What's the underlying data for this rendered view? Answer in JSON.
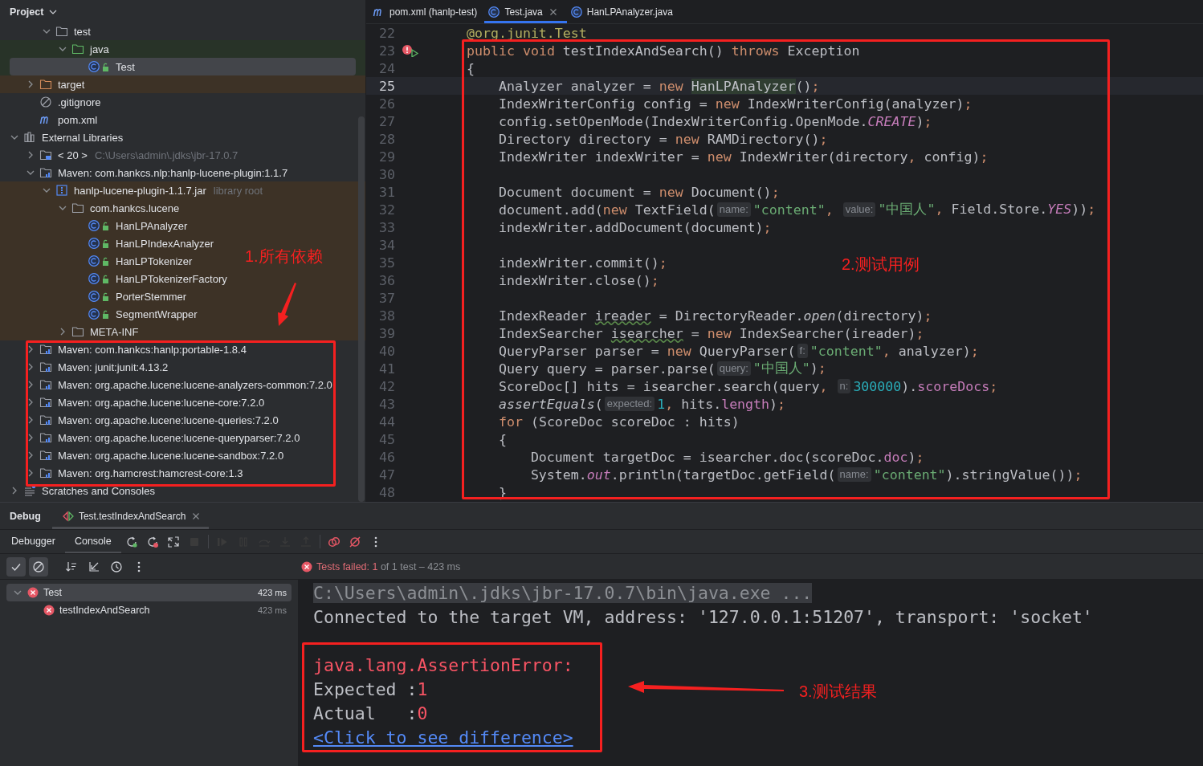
{
  "project": {
    "title": "Project",
    "tree": [
      {
        "children": [
          {
            "children": [
              {
                "label": "test",
                "kind": "folder",
                "expanded": true,
                "selected": false,
                "children": [
                  {
                    "label": "java",
                    "kind": "test-folder",
                    "expanded": true,
                    "selected": false,
                    "color": "#283328",
                    "children": [
                      {
                        "label": "Test",
                        "kind": "class",
                        "selected": true,
                        "color": "#283328"
                      }
                    ]
                  }
                ]
              }
            ]
          },
          {
            "label": "target",
            "kind": "excluded-folder",
            "expanded": false,
            "selected": false,
            "color": "#3d3226"
          },
          {
            "label": ".gitignore",
            "kind": "ignored",
            "selected": false
          },
          {
            "label": "pom.xml",
            "kind": "maven",
            "selected": false
          }
        ]
      },
      {
        "label": "External Libraries",
        "kind": "libraries",
        "expanded": true,
        "selected": false,
        "children": [
          {
            "label": "< 20 >",
            "kind": "sdk",
            "expanded": false,
            "selected": false,
            "hint": "C:\\Users\\admin\\.jdks\\jbr-17.0.7"
          },
          {
            "label": "Maven: com.hankcs.nlp:hanlp-lucene-plugin:1.1.7",
            "kind": "library",
            "expanded": true,
            "selected": false,
            "children": [
              {
                "label": "hanlp-lucene-plugin-1.1.7.jar",
                "kind": "archive",
                "expanded": true,
                "selected": false,
                "color": "#3d3226",
                "hint": "library root",
                "children": [
                  {
                    "label": "com.hankcs.lucene",
                    "kind": "folder",
                    "expanded": true,
                    "selected": false,
                    "color": "#3d3226",
                    "children": [
                      {
                        "label": "HanLPAnalyzer",
                        "kind": "class",
                        "selected": false,
                        "color": "#3d3226"
                      },
                      {
                        "label": "HanLPIndexAnalyzer",
                        "kind": "class",
                        "selected": false,
                        "color": "#3d3226"
                      },
                      {
                        "label": "HanLPTokenizer",
                        "kind": "class",
                        "selected": false,
                        "color": "#3d3226"
                      },
                      {
                        "label": "HanLPTokenizerFactory",
                        "kind": "class",
                        "selected": false,
                        "color": "#3d3226"
                      },
                      {
                        "label": "PorterStemmer",
                        "kind": "class",
                        "selected": false,
                        "color": "#3d3226"
                      },
                      {
                        "label": "SegmentWrapper",
                        "kind": "class",
                        "selected": false,
                        "color": "#3d3226"
                      }
                    ]
                  },
                  {
                    "label": "META-INF",
                    "kind": "folder",
                    "expanded": false,
                    "selected": false,
                    "color": "#3d3226"
                  }
                ]
              }
            ]
          },
          {
            "label": "Maven: com.hankcs:hanlp:portable-1.8.4",
            "kind": "library",
            "expanded": false,
            "selected": false
          },
          {
            "label": "Maven: junit:junit:4.13.2",
            "kind": "library",
            "expanded": false,
            "selected": false
          },
          {
            "label": "Maven: org.apache.lucene:lucene-analyzers-common:7.2.0",
            "kind": "library",
            "expanded": false,
            "selected": false
          },
          {
            "label": "Maven: org.apache.lucene:lucene-core:7.2.0",
            "kind": "library",
            "expanded": false,
            "selected": false
          },
          {
            "label": "Maven: org.apache.lucene:lucene-queries:7.2.0",
            "kind": "library",
            "expanded": false,
            "selected": false
          },
          {
            "label": "Maven: org.apache.lucene:lucene-queryparser:7.2.0",
            "kind": "library",
            "expanded": false,
            "selected": false
          },
          {
            "label": "Maven: org.apache.lucene:lucene-sandbox:7.2.0",
            "kind": "library",
            "expanded": false,
            "selected": false
          },
          {
            "label": "Maven: org.hamcrest:hamcrest-core:1.3",
            "kind": "library",
            "expanded": false,
            "selected": false
          }
        ]
      },
      {
        "label": "Scratches and Consoles",
        "kind": "scratches",
        "expanded": false,
        "selected": false
      }
    ]
  },
  "editor": {
    "tabs": [
      {
        "label": "pom.xml (hanlp-test)",
        "kind": "maven",
        "selected": false
      },
      {
        "label": "Test.java",
        "kind": "class",
        "selected": true,
        "closable": true
      },
      {
        "label": "HanLPAnalyzer.java",
        "kind": "class",
        "selected": false
      }
    ],
    "lines": [
      {
        "no": "22",
        "current": false,
        "tokens": [
          {
            "kind": "annotation",
            "text": "    @org.junit.Test"
          }
        ]
      },
      {
        "no": "23",
        "current": false,
        "run_error": true,
        "tokens": [
          {
            "kind": "keyword",
            "text": "    public "
          },
          {
            "kind": "keyword",
            "text": "void"
          },
          {
            "kind": "plain",
            "text": " testIndexAndSearch() "
          },
          {
            "kind": "keyword",
            "text": "throws"
          },
          {
            "kind": "plain",
            "text": " Exception"
          }
        ]
      },
      {
        "no": "24",
        "current": false,
        "tokens": [
          {
            "kind": "plain",
            "text": "    {"
          }
        ]
      },
      {
        "no": "25",
        "current": true,
        "tokens": [
          {
            "kind": "plain",
            "text": "        Analyzer analyzer = "
          },
          {
            "kind": "keyword",
            "text": "new "
          },
          {
            "kind": "match",
            "text": "HanLPAnalyzer"
          },
          {
            "kind": "plain",
            "text": "()"
          },
          {
            "kind": "punct",
            "text": ";"
          }
        ]
      },
      {
        "no": "26",
        "current": false,
        "tokens": [
          {
            "kind": "plain",
            "text": "        IndexWriterConfig config = "
          },
          {
            "kind": "keyword",
            "text": "new"
          },
          {
            "kind": "plain",
            "text": " IndexWriterConfig(analyzer)"
          },
          {
            "kind": "punct",
            "text": ";"
          }
        ]
      },
      {
        "no": "27",
        "current": false,
        "tokens": [
          {
            "kind": "plain",
            "text": "        config.setOpenMode(IndexWriterConfig.OpenMode."
          },
          {
            "kind": "static-field",
            "text": "CREATE"
          },
          {
            "kind": "plain",
            "text": ")"
          },
          {
            "kind": "punct",
            "text": ";"
          }
        ]
      },
      {
        "no": "28",
        "current": false,
        "tokens": [
          {
            "kind": "plain",
            "text": "        Directory directory = "
          },
          {
            "kind": "keyword",
            "text": "new"
          },
          {
            "kind": "plain",
            "text": " RAMDirectory()"
          },
          {
            "kind": "punct",
            "text": ";"
          }
        ]
      },
      {
        "no": "29",
        "current": false,
        "tokens": [
          {
            "kind": "plain",
            "text": "        IndexWriter indexWriter = "
          },
          {
            "kind": "keyword",
            "text": "new"
          },
          {
            "kind": "plain",
            "text": " IndexWriter(directory"
          },
          {
            "kind": "punct",
            "text": ","
          },
          {
            "kind": "plain",
            "text": " config)"
          },
          {
            "kind": "punct",
            "text": ";"
          }
        ]
      },
      {
        "no": "30",
        "current": false
      },
      {
        "no": "31",
        "current": false,
        "tokens": [
          {
            "kind": "plain",
            "text": "        Document document = "
          },
          {
            "kind": "keyword",
            "text": "new"
          },
          {
            "kind": "plain",
            "text": " Document()"
          },
          {
            "kind": "punct",
            "text": ";"
          }
        ]
      },
      {
        "no": "32",
        "current": false,
        "tokens": [
          {
            "kind": "plain",
            "text": "        document.add("
          },
          {
            "kind": "keyword",
            "text": "new"
          },
          {
            "kind": "plain",
            "text": " TextField("
          },
          {
            "kind": "hint",
            "text": "name:"
          },
          {
            "kind": "string",
            "text": "\"content\""
          },
          {
            "kind": "punct",
            "text": ", "
          },
          {
            "kind": "hint",
            "text": "value:"
          },
          {
            "kind": "string",
            "text": "\"中国人\""
          },
          {
            "kind": "punct",
            "text": ","
          },
          {
            "kind": "plain",
            "text": " Field.Store."
          },
          {
            "kind": "static-field",
            "text": "YES"
          },
          {
            "kind": "plain",
            "text": "))"
          },
          {
            "kind": "punct",
            "text": ";"
          }
        ]
      },
      {
        "no": "33",
        "current": false,
        "tokens": [
          {
            "kind": "plain",
            "text": "        indexWriter.addDocument(document)"
          },
          {
            "kind": "punct",
            "text": ";"
          }
        ]
      },
      {
        "no": "34",
        "current": false
      },
      {
        "no": "35",
        "current": false,
        "tokens": [
          {
            "kind": "plain",
            "text": "        indexWriter.commit()"
          },
          {
            "kind": "punct",
            "text": ";"
          }
        ]
      },
      {
        "no": "36",
        "current": false,
        "tokens": [
          {
            "kind": "plain",
            "text": "        indexWriter.close()"
          },
          {
            "kind": "punct",
            "text": ";"
          }
        ]
      },
      {
        "no": "37",
        "current": false
      },
      {
        "no": "38",
        "current": false,
        "tokens": [
          {
            "kind": "plain",
            "text": "        IndexReader "
          },
          {
            "kind": "unused",
            "text": "ireader"
          },
          {
            "kind": "plain",
            "text": " = DirectoryReader."
          },
          {
            "kind": "static-call",
            "text": "open"
          },
          {
            "kind": "plain",
            "text": "(directory)"
          },
          {
            "kind": "punct",
            "text": ";"
          }
        ]
      },
      {
        "no": "39",
        "current": false,
        "tokens": [
          {
            "kind": "plain",
            "text": "        IndexSearcher "
          },
          {
            "kind": "unused",
            "text": "isearcher"
          },
          {
            "kind": "plain",
            "text": " = "
          },
          {
            "kind": "keyword",
            "text": "new"
          },
          {
            "kind": "plain",
            "text": " IndexSearcher(ireader)"
          },
          {
            "kind": "punct",
            "text": ";"
          }
        ]
      },
      {
        "no": "40",
        "current": false,
        "tokens": [
          {
            "kind": "plain",
            "text": "        QueryParser parser = "
          },
          {
            "kind": "keyword",
            "text": "new"
          },
          {
            "kind": "plain",
            "text": " QueryParser("
          },
          {
            "kind": "hint",
            "text": "f:"
          },
          {
            "kind": "string",
            "text": "\"content\""
          },
          {
            "kind": "punct",
            "text": ","
          },
          {
            "kind": "plain",
            "text": " analyzer)"
          },
          {
            "kind": "punct",
            "text": ";"
          }
        ]
      },
      {
        "no": "41",
        "current": false,
        "tokens": [
          {
            "kind": "plain",
            "text": "        Query query = parser.parse("
          },
          {
            "kind": "hint",
            "text": "query:"
          },
          {
            "kind": "string",
            "text": "\"中国人\""
          },
          {
            "kind": "plain",
            "text": ")"
          },
          {
            "kind": "punct",
            "text": ";"
          }
        ]
      },
      {
        "no": "42",
        "current": false,
        "tokens": [
          {
            "kind": "plain",
            "text": "        ScoreDoc[] hits = isearcher.search(query"
          },
          {
            "kind": "punct",
            "text": ", "
          },
          {
            "kind": "hint",
            "text": "n:"
          },
          {
            "kind": "number",
            "text": "300000"
          },
          {
            "kind": "plain",
            "text": ")."
          },
          {
            "kind": "field",
            "text": "scoreDocs"
          },
          {
            "kind": "punct",
            "text": ";"
          }
        ]
      },
      {
        "no": "43",
        "current": false,
        "tokens": [
          {
            "kind": "assert-call",
            "text": "        assertEquals"
          },
          {
            "kind": "plain",
            "text": "("
          },
          {
            "kind": "hint",
            "text": "expected:"
          },
          {
            "kind": "number",
            "text": "1"
          },
          {
            "kind": "punct",
            "text": ","
          },
          {
            "kind": "plain",
            "text": " hits."
          },
          {
            "kind": "field",
            "text": "length"
          },
          {
            "kind": "plain",
            "text": ")"
          },
          {
            "kind": "punct",
            "text": ";"
          }
        ]
      },
      {
        "no": "44",
        "current": false,
        "tokens": [
          {
            "kind": "keyword",
            "text": "        for"
          },
          {
            "kind": "plain",
            "text": " (ScoreDoc scoreDoc : hits)"
          }
        ]
      },
      {
        "no": "45",
        "current": false,
        "tokens": [
          {
            "kind": "plain",
            "text": "        {"
          }
        ]
      },
      {
        "no": "46",
        "current": false,
        "tokens": [
          {
            "kind": "plain",
            "text": "            Document targetDoc = isearcher.doc(scoreDoc."
          },
          {
            "kind": "field",
            "text": "doc"
          },
          {
            "kind": "plain",
            "text": ")"
          },
          {
            "kind": "punct",
            "text": ";"
          }
        ]
      },
      {
        "no": "47",
        "current": false,
        "tokens": [
          {
            "kind": "plain",
            "text": "            System."
          },
          {
            "kind": "static-field",
            "text": "out"
          },
          {
            "kind": "plain",
            "text": ".println(targetDoc.getField("
          },
          {
            "kind": "hint",
            "text": "name:"
          },
          {
            "kind": "string",
            "text": "\"content\""
          },
          {
            "kind": "plain",
            "text": ").stringValue())"
          },
          {
            "kind": "punct",
            "text": ";"
          }
        ]
      },
      {
        "no": "48",
        "current": false,
        "tokens": [
          {
            "kind": "plain",
            "text": "        }"
          }
        ]
      }
    ]
  },
  "debug": {
    "title": "Debug",
    "tabs": [
      {
        "label": "Test.testIndexAndSearch",
        "selected": true
      }
    ],
    "subtabs": [
      {
        "label": "Debugger",
        "selected": false
      },
      {
        "label": "Console",
        "selected": true
      }
    ],
    "toolbar": [
      {
        "kind": "rerun",
        "disabled": false
      },
      {
        "kind": "rerun-failed",
        "disabled": false
      },
      {
        "kind": "restore",
        "disabled": false
      },
      {
        "kind": "stop",
        "disabled": true
      },
      {
        "kind": "separator"
      },
      {
        "kind": "resume",
        "disabled": true
      },
      {
        "kind": "pause",
        "disabled": true
      },
      {
        "kind": "step-over",
        "disabled": true
      },
      {
        "kind": "step-into",
        "disabled": true
      },
      {
        "kind": "step-out",
        "disabled": true
      },
      {
        "kind": "separator"
      },
      {
        "kind": "breakpoints",
        "disabled": false
      },
      {
        "kind": "mute",
        "disabled": false
      },
      {
        "kind": "more",
        "disabled": false
      }
    ],
    "test_toolbar": [
      {
        "kind": "show-passed",
        "selected": true
      },
      {
        "kind": "show-ignored",
        "selected": true
      },
      {
        "kind": "separator"
      },
      {
        "kind": "sort",
        "selected": false
      },
      {
        "kind": "export",
        "selected": false
      },
      {
        "kind": "history",
        "selected": false
      },
      {
        "kind": "more",
        "selected": false
      }
    ],
    "status": {
      "failed": "Tests failed: 1",
      "rest": "of 1 test – 423 ms"
    },
    "results": [
      {
        "label": "Test",
        "time": "423 ms",
        "failed": true,
        "expanded": true,
        "selected": true,
        "children": [
          {
            "label": "testIndexAndSearch",
            "time": "423 ms",
            "failed": true,
            "selected": false
          }
        ]
      }
    ],
    "console": {
      "lines": [
        {
          "kind": "command",
          "text": "C:\\Users\\admin\\.jdks\\jbr-17.0.7\\bin\\java.exe ..."
        },
        {
          "kind": "plain",
          "text": "Connected to the target VM, address: '127.0.0.1:51207', transport: 'socket'"
        }
      ],
      "failure": {
        "error": "java.lang.AssertionError:",
        "expected_label": "Expected :",
        "expected": "1",
        "actual_label": "Actual   :",
        "actual": "0",
        "link": "<Click to see difference>"
      }
    }
  },
  "annotations": [
    {
      "text": "1.所有依赖"
    },
    {
      "text": "2.测试用例"
    },
    {
      "text": "3.测试结果"
    }
  ]
}
